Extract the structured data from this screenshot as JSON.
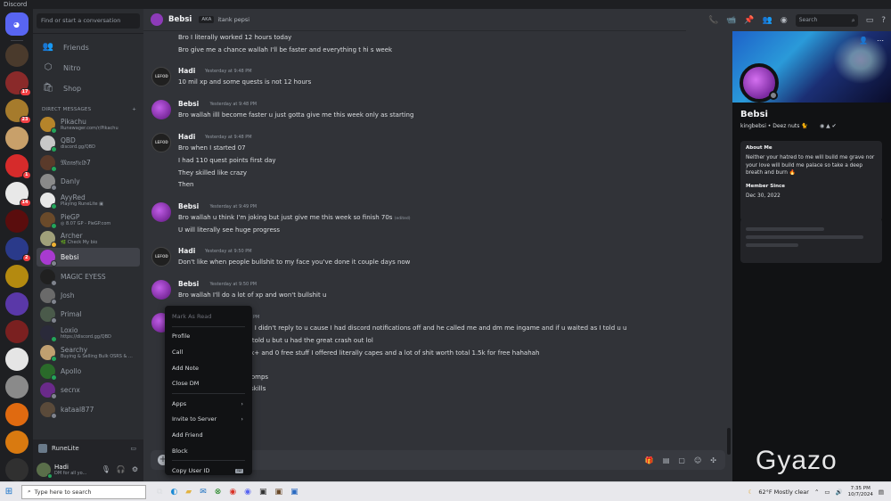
{
  "window": {
    "title": "Discord"
  },
  "servers": {
    "items": [
      {
        "name": "home",
        "bg": "#5865f2",
        "badge": ""
      },
      {
        "name": "server-1",
        "bg": "#4a3a2c",
        "badge": ""
      },
      {
        "name": "server-2",
        "bg": "#8a2a2a",
        "badge": "17"
      },
      {
        "name": "server-3",
        "bg": "#a67b2c",
        "badge": "23"
      },
      {
        "name": "server-4",
        "bg": "#c8a06a",
        "badge": ""
      },
      {
        "name": "server-5",
        "bg": "#d62b2b",
        "badge": "1"
      },
      {
        "name": "server-6",
        "bg": "#e8e8e8",
        "badge": "14"
      },
      {
        "name": "server-7",
        "bg": "#5a0d0d",
        "badge": ""
      },
      {
        "name": "server-8",
        "bg": "#2a3a8a",
        "badge": "2"
      },
      {
        "name": "server-9",
        "bg": "#b48a10",
        "badge": ""
      },
      {
        "name": "server-10",
        "bg": "#5a38a8",
        "badge": ""
      },
      {
        "name": "server-11",
        "bg": "#7a2020",
        "badge": ""
      },
      {
        "name": "server-12",
        "bg": "#e5e5e5",
        "badge": ""
      },
      {
        "name": "server-13",
        "bg": "#8a8a8a",
        "badge": ""
      },
      {
        "name": "server-14",
        "bg": "#e06a10",
        "badge": ""
      },
      {
        "name": "server-15",
        "bg": "#d97a10",
        "badge": ""
      },
      {
        "name": "server-16",
        "bg": "#303030",
        "badge": ""
      }
    ]
  },
  "dms": {
    "search_placeholder": "Find or start a conversation",
    "nav": [
      {
        "label": "Friends",
        "icon": "👥"
      },
      {
        "label": "Nitro",
        "icon": "⬡"
      },
      {
        "label": "Shop",
        "icon": "🛍"
      }
    ],
    "section_label": "DIRECT MESSAGES",
    "add_icon": "+",
    "items": [
      {
        "name": "Pikachu",
        "sub": "Runewager.com/r/Pikachu",
        "color": "#b5842a",
        "status": "#23a55a"
      },
      {
        "name": "QBD",
        "sub": "discord.gg/QBD",
        "color": "#c8c8c8",
        "status": "#23a55a"
      },
      {
        "name": "𝔐𝔞𝔫𝔰𝔣𝔦𝔢𝔩𝔡7",
        "sub": "",
        "color": "#5a3a2a",
        "status": "#23a55a"
      },
      {
        "name": "Danly",
        "sub": "",
        "color": "#8a8a8a",
        "status": "#80848e"
      },
      {
        "name": "AyyRed",
        "sub": "Playing RuneLite ▣",
        "color": "#e8e8e8",
        "status": "#23a55a"
      },
      {
        "name": "PieGP",
        "sub": "◎ 8.07 GP - PieGP.com",
        "color": "#6a4a2a",
        "status": "#23a55a"
      },
      {
        "name": "Archer",
        "sub": "🌿 Check My bio",
        "color": "#a0a07a",
        "status": "#f0b232"
      },
      {
        "name": "Bebsi",
        "sub": "",
        "color": "#a83ad0",
        "status": "#80848e"
      },
      {
        "name": "MAGIC EYESS",
        "sub": "",
        "color": "#202020",
        "status": "#80848e"
      },
      {
        "name": "Josh",
        "sub": "",
        "color": "#6a6a6a",
        "status": "#80848e"
      },
      {
        "name": "Primal",
        "sub": "",
        "color": "#4a5a4a",
        "status": "#80848e"
      },
      {
        "name": "Loxio",
        "sub": "https://discord.gg/QBD",
        "color": "#2a2a3a",
        "status": "#23a55a"
      },
      {
        "name": "Searchy",
        "sub": "Buying & Selling Bulk OSRS & ...",
        "color": "#c0a070",
        "status": "#23a55a"
      },
      {
        "name": "Apollo",
        "sub": "",
        "color": "#2a6a2a",
        "status": "#23a55a"
      },
      {
        "name": "secnx",
        "sub": "",
        "color": "#6a2a8a",
        "status": "#80848e"
      },
      {
        "name": "kataal877",
        "sub": "",
        "color": "#5a4a3a",
        "status": "#80848e"
      }
    ],
    "runelite_label": "RuneLite",
    "user": {
      "name": "Hadi",
      "sub": "DM for all yo..."
    }
  },
  "header": {
    "name": "Bebsi",
    "aka": "AKA",
    "alias": "itank pepsi",
    "search_placeholder": "Search"
  },
  "messages": [
    {
      "type": "cont",
      "text": "Bro I literally worked 12 hours today"
    },
    {
      "type": "cont",
      "text": "Bro give me a chance wallah I'll be faster and everything t hi s week"
    },
    {
      "type": "head",
      "author": "Hadi",
      "time": "Yesterday at 9:48 PM",
      "avatar": "h",
      "text": "10 mil xp and some quests is not 12 hours"
    },
    {
      "type": "head",
      "author": "Bebsi",
      "time": "Yesterday at 9:48 PM",
      "avatar": "b",
      "text": "Bro wallah illl become faster u just gotta give me this week only as starting"
    },
    {
      "type": "head",
      "author": "Hadi",
      "time": "Yesterday at 9:48 PM",
      "avatar": "h",
      "text": "Bro when I started 07"
    },
    {
      "type": "cont",
      "text": "I had 110 quest points first day"
    },
    {
      "type": "cont",
      "text": "They skilled like crazy"
    },
    {
      "type": "cont",
      "text": "Then"
    },
    {
      "type": "head",
      "author": "Bebsi",
      "time": "Yesterday at 9:49 PM",
      "avatar": "b",
      "text": "Bro wallah u think I'm joking but just give me this week so finish 70s",
      "edited": "(edited)"
    },
    {
      "type": "cont",
      "text": "U will literally see huge progress"
    },
    {
      "type": "head",
      "author": "Hadi",
      "time": "Yesterday at 9:50 PM",
      "avatar": "h",
      "text": "Don't like when people bullshit to my face you've done it couple days now"
    },
    {
      "type": "head",
      "author": "Bebsi",
      "time": "Yesterday at 9:50 PM",
      "avatar": "b",
      "text": "Bro wallah I'll do a lot of xp and won't bullshit u"
    },
    {
      "type": "head",
      "author": "Bebsi",
      "time": "Yesterday at 11:05 PM",
      "avatar": "b",
      "text": "hed out the only reason I didn't reply to u cause I had discord notifications off and he called me and dm me ingame and if u waited as I told u u"
    },
    {
      "type": "cont",
      "text": "80s on Wednesday as I told u but  u had the great crash out lol"
    },
    {
      "type": "cont",
      "text": "nerched by him rn 😂 5k+ and 0 free stuff I offered literally capes and a lot of shit worth total 1.5k for free hahahah"
    },
    {
      "type": "cont",
      "text": "han baby sitting you"
    },
    {
      "type": "cont",
      "text": "ach me when u had 0 comps"
    },
    {
      "type": "cont",
      "text": "omps and 200m xp 10 skills"
    }
  ],
  "context_menu": {
    "items": [
      {
        "label": "Mark As Read",
        "dim": true,
        "arrow": ""
      },
      {
        "sep": true
      },
      {
        "label": "Profile",
        "arrow": ""
      },
      {
        "label": "Call",
        "arrow": ""
      },
      {
        "label": "Add Note",
        "arrow": ""
      },
      {
        "label": "Close DM",
        "arrow": ""
      },
      {
        "sep": true
      },
      {
        "label": "Apps",
        "arrow": "›"
      },
      {
        "label": "Invite to Server",
        "arrow": "›"
      },
      {
        "label": "Add Friend",
        "arrow": ""
      },
      {
        "label": "Block",
        "arrow": ""
      },
      {
        "sep": true
      },
      {
        "label": "Copy User ID",
        "arrow": "ID"
      }
    ]
  },
  "profile": {
    "name": "Bebsi",
    "tag": "kingbebsi • Deez nuts 🐈",
    "about_label": "About Me",
    "about_text": "Neither your hatred to me will build me grave nor your love will build me palace so take a deep breath and burn 🔥",
    "member_since_label": "Member Since",
    "member_since": "Dec 30, 2022"
  },
  "taskbar": {
    "search_placeholder": "Type here to search",
    "weather": "62°F  Mostly clear",
    "time": "7:35 PM",
    "date": "10/7/2024"
  },
  "watermark": "Gyazo"
}
